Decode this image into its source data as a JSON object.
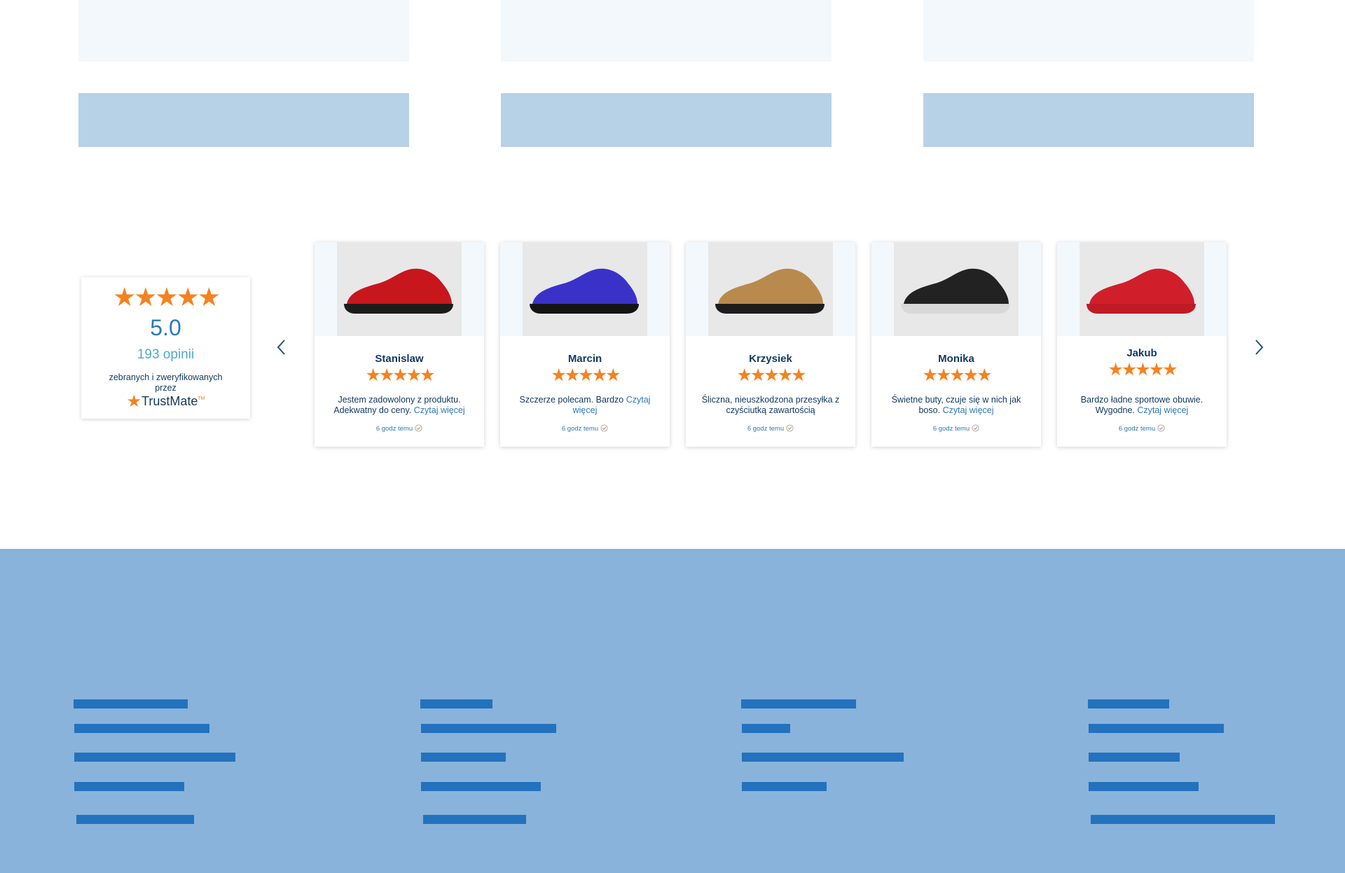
{
  "summary": {
    "stars": "★★★★★",
    "score": "5.0",
    "opinions": "193 opinii",
    "collected_text": "zebranych i zweryfikowanych przez",
    "brand_trust": "Trust",
    "brand_mate": "Mate",
    "brand_tm": "TM",
    "rating_value": 5
  },
  "reviews": [
    {
      "name": "Stanislaw",
      "stars": "★★★★★",
      "rating": 5,
      "text": "Jestem zadowolony z produktu. Adekwatny do ceny.",
      "read_more": "Czytaj więcej",
      "time": "6 godz temu",
      "shoe_color": "#c8161d",
      "sole_color": "#1c1c1c"
    },
    {
      "name": "Marcin",
      "stars": "★★★★★",
      "rating": 5,
      "text": "Szczerze polecam. Bardzo",
      "read_more": "Czytaj więcej",
      "time": "6 godz temu",
      "shoe_color": "#3a32c8",
      "sole_color": "#141414"
    },
    {
      "name": "Krzysiek",
      "stars": "★★★★★",
      "rating": 5,
      "text": "Śliczna, nieuszkodzona przesyłka z czyściutką zawartością",
      "read_more": "",
      "time": "6 godz temu",
      "shoe_color": "#b88a4e",
      "sole_color": "#1c1c1c"
    },
    {
      "name": "Monika",
      "stars": "★★★★★",
      "rating": 5,
      "text": "Świetne buty, czuje się w nich jak boso.",
      "read_more": "Czytaj więcej",
      "time": "6 godz temu",
      "shoe_color": "#222222",
      "sole_color": "#d8d8d8"
    },
    {
      "name": "Jakub",
      "stars": "★★★★★",
      "rating": 5,
      "text": "Bardzo ładne sportowe obuwie. Wygodne.",
      "read_more": "Czytaj więcej",
      "time": "6 godz temu",
      "shoe_color": "#d01f2a",
      "sole_color": "#c01a24"
    }
  ],
  "icons": {
    "prev": "chevron-left-icon",
    "next": "chevron-right-icon",
    "verified": "verified-check-icon",
    "star": "star-icon"
  },
  "colors": {
    "accent_orange": "#f58220",
    "text_navy": "#143a63",
    "link_blue": "#2f78b7",
    "footer_bg": "#89b3db",
    "footer_bar": "#2372bd"
  }
}
